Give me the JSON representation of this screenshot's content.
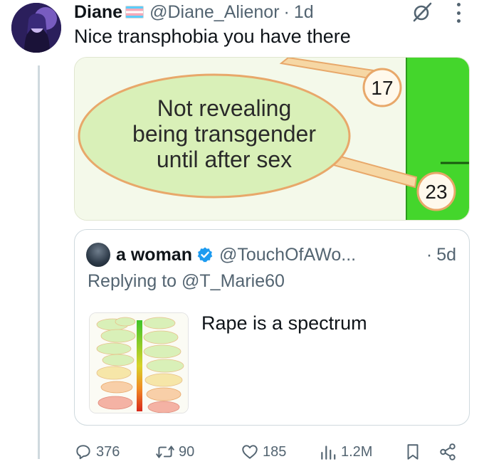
{
  "tweet": {
    "display_name": "Diane",
    "badge": "trans-flag",
    "handle": "@Diane_Alienor",
    "separator": "·",
    "time": "1d",
    "text": "Nice transphobia you have there",
    "media": {
      "bubble_lines": [
        "Not revealing",
        "being transgender",
        "until after sex"
      ],
      "badge_top": "17",
      "badge_bottom": "23"
    }
  },
  "quote": {
    "display_name": "a woman",
    "handle": "@TouchOfAWo...",
    "separator": "·",
    "time": "5d",
    "replying_prefix": "Replying to",
    "replying_to": "@T_Marie60",
    "text": "Rape is a spectrum"
  },
  "actions": {
    "replies": "376",
    "retweets": "90",
    "likes": "185",
    "views": "1.2M"
  },
  "colors": {
    "text_primary": "#0f1419",
    "text_secondary": "#536471",
    "border": "#cfd9de",
    "verified": "#1d9bf0",
    "bubble_fill": "#d9f0b8",
    "bubble_stroke": "#e8a86a",
    "green_bar": "#44d62c"
  }
}
